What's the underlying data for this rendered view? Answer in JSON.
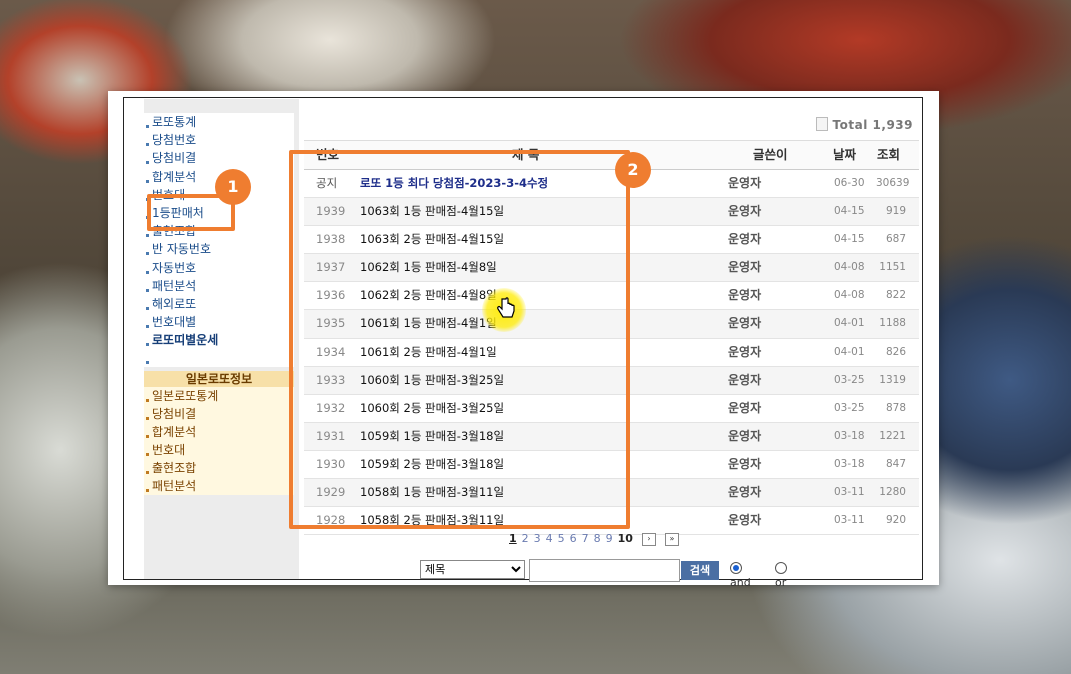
{
  "sidebar": {
    "items": [
      {
        "label": "로또통계",
        "bold": false
      },
      {
        "label": "당첨번호",
        "bold": false
      },
      {
        "label": "당첨비결",
        "bold": false
      },
      {
        "label": "합계분석",
        "bold": false
      },
      {
        "label": "번호대",
        "bold": false
      },
      {
        "label": "1등판매처",
        "bold": false
      },
      {
        "label": "출현조합",
        "bold": false
      },
      {
        "label": "반 자동번호",
        "bold": false
      },
      {
        "label": "자동번호",
        "bold": false
      },
      {
        "label": "패턴분석",
        "bold": false
      },
      {
        "label": "해외로또",
        "bold": false
      },
      {
        "label": "번호대별",
        "bold": false
      },
      {
        "label": "로또띠별운세",
        "bold": true
      }
    ],
    "japan_header": "일본로또정보",
    "japan_items": [
      "일본로또통계",
      "당첨비결",
      "합계분석",
      "번호대",
      "출현조합",
      "패턴분석"
    ]
  },
  "board": {
    "total_label": "Total",
    "total_value": "1,939",
    "headers": {
      "no": "번호",
      "title": "제 목",
      "writer": "글쓴이",
      "date": "날짜",
      "views": "조회"
    },
    "rows": [
      {
        "no": "공지",
        "title": "로또 1등 최다 당첨점-2023-3-4수정",
        "writer": "운영자",
        "date": "06-30",
        "views": "30639"
      },
      {
        "no": "1939",
        "title": "1063회 1등 판매점-4월15일",
        "writer": "운영자",
        "date": "04-15",
        "views": "919"
      },
      {
        "no": "1938",
        "title": "1063회 2등 판매점-4월15일",
        "writer": "운영자",
        "date": "04-15",
        "views": "687"
      },
      {
        "no": "1937",
        "title": "1062회 1등 판매점-4월8일",
        "writer": "운영자",
        "date": "04-08",
        "views": "1151"
      },
      {
        "no": "1936",
        "title": "1062회 2등 판매점-4월8일",
        "writer": "운영자",
        "date": "04-08",
        "views": "822"
      },
      {
        "no": "1935",
        "title": "1061회 1등 판매점-4월1일",
        "writer": "운영자",
        "date": "04-01",
        "views": "1188"
      },
      {
        "no": "1934",
        "title": "1061회 2등 판매점-4월1일",
        "writer": "운영자",
        "date": "04-01",
        "views": "826"
      },
      {
        "no": "1933",
        "title": "1060회 1등 판매점-3월25일",
        "writer": "운영자",
        "date": "03-25",
        "views": "1319"
      },
      {
        "no": "1932",
        "title": "1060회 2등 판매점-3월25일",
        "writer": "운영자",
        "date": "03-25",
        "views": "878"
      },
      {
        "no": "1931",
        "title": "1059회 1등 판매점-3월18일",
        "writer": "운영자",
        "date": "03-18",
        "views": "1221"
      },
      {
        "no": "1930",
        "title": "1059회 2등 판매점-3월18일",
        "writer": "운영자",
        "date": "03-18",
        "views": "847"
      },
      {
        "no": "1929",
        "title": "1058회 1등 판매점-3월11일",
        "writer": "운영자",
        "date": "03-11",
        "views": "1280"
      },
      {
        "no": "1928",
        "title": "1058회 2등 판매점-3월11일",
        "writer": "운영자",
        "date": "03-11",
        "views": "920"
      }
    ]
  },
  "pagination": {
    "pages": [
      "1",
      "2",
      "3",
      "4",
      "5",
      "6",
      "7",
      "8",
      "9",
      "10"
    ],
    "next": "›",
    "last": "»"
  },
  "search": {
    "field_option": "제목",
    "button_label": "검색",
    "and_label": "and",
    "or_label": "or"
  },
  "annotations": {
    "badge1": "1",
    "badge2": "2",
    "highlight_color": "#ef7d30"
  }
}
